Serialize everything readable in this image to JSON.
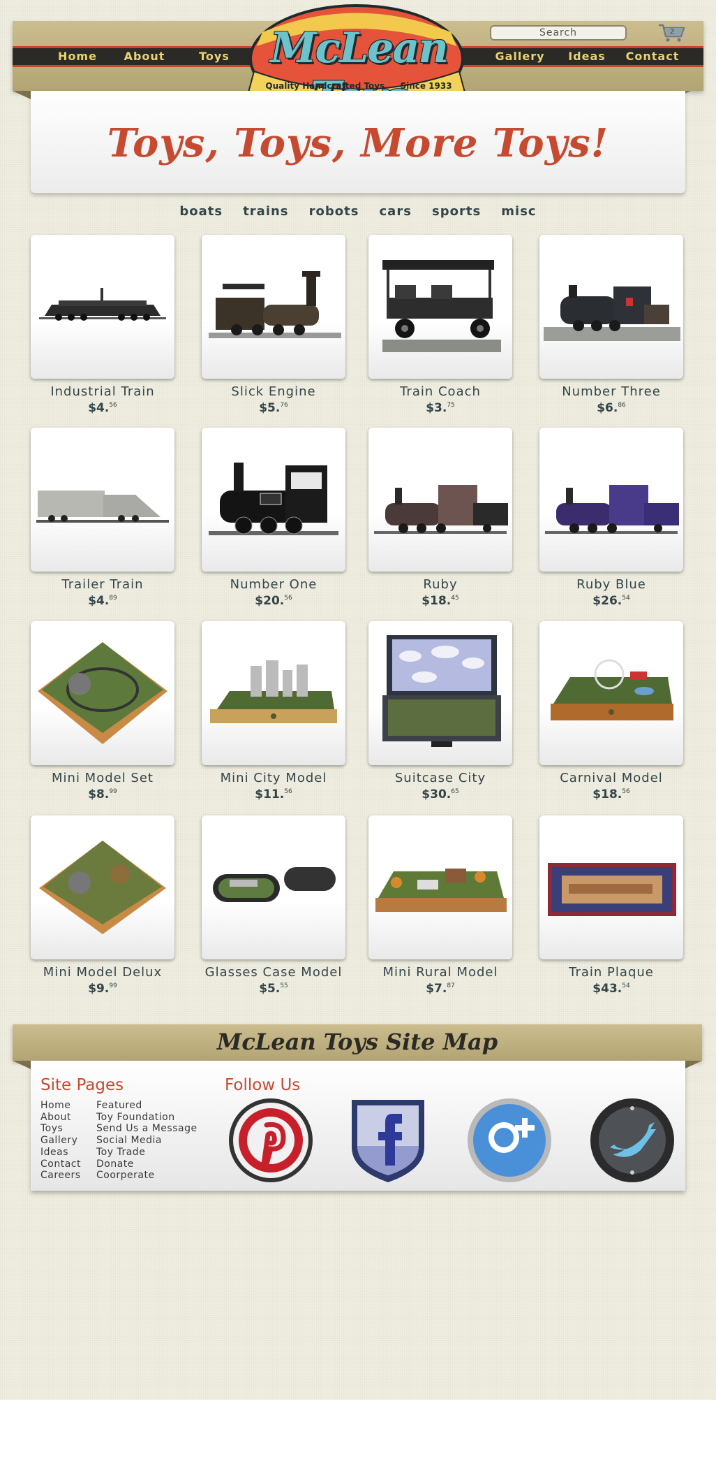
{
  "brand": {
    "name": "McLean Toys",
    "tagline": "Quality Handcrafted Toys",
    "since": "Since 1933"
  },
  "header": {
    "nav_left": [
      "Home",
      "About",
      "Toys"
    ],
    "nav_right": [
      "Gallery",
      "Ideas",
      "Contact"
    ],
    "search_placeholder": "Search",
    "cart_icon": "cart-icon",
    "cart_count": "2"
  },
  "hero": {
    "title": "Toys, Toys, More Toys!"
  },
  "categories": [
    "boats",
    "trains",
    "robots",
    "cars",
    "sports",
    "misc"
  ],
  "products": [
    {
      "name": "Industrial Train",
      "dollars": "$4.",
      "cents": "56"
    },
    {
      "name": "Slick Engine",
      "dollars": "$5.",
      "cents": "76"
    },
    {
      "name": "Train Coach",
      "dollars": "$3.",
      "cents": "75"
    },
    {
      "name": "Number Three",
      "dollars": "$6.",
      "cents": "86"
    },
    {
      "name": "Trailer Train",
      "dollars": "$4.",
      "cents": "89"
    },
    {
      "name": "Number One",
      "dollars": "$20.",
      "cents": "56"
    },
    {
      "name": "Ruby",
      "dollars": "$18.",
      "cents": "45"
    },
    {
      "name": "Ruby Blue",
      "dollars": "$26.",
      "cents": "54"
    },
    {
      "name": "Mini Model Set",
      "dollars": "$8.",
      "cents": "99"
    },
    {
      "name": "Mini City Model",
      "dollars": "$11.",
      "cents": "56"
    },
    {
      "name": "Suitcase City",
      "dollars": "$30.",
      "cents": "65"
    },
    {
      "name": "Carnival Model",
      "dollars": "$18.",
      "cents": "56"
    },
    {
      "name": "Mini Model Delux",
      "dollars": "$9.",
      "cents": "99"
    },
    {
      "name": "Glasses Case Model",
      "dollars": "$5.",
      "cents": "55"
    },
    {
      "name": "Mini Rural Model",
      "dollars": "$7.",
      "cents": "87"
    },
    {
      "name": "Train Plaque",
      "dollars": "$43.",
      "cents": "54"
    }
  ],
  "sitemap": {
    "title": "McLean Toys Site Map",
    "pages_heading": "Site Pages",
    "pages_col1": [
      "Home",
      "About",
      "Toys",
      "Gallery",
      "Ideas",
      "Contact",
      "Careers"
    ],
    "pages_col2": [
      "Featured",
      "Toy Foundation",
      "Send Us a Message",
      "Social Media",
      "Toy Trade",
      "Donate",
      "Coorperate"
    ],
    "follow_heading": "Follow Us",
    "social_icons": [
      "pinterest-icon",
      "facebook-icon",
      "google-plus-icon",
      "twitter-icon"
    ]
  },
  "colors": {
    "accent_red": "#c64a30",
    "nav_gold": "#ecd272",
    "banner_tan": "#c2b383",
    "dark": "#2a2a26"
  }
}
